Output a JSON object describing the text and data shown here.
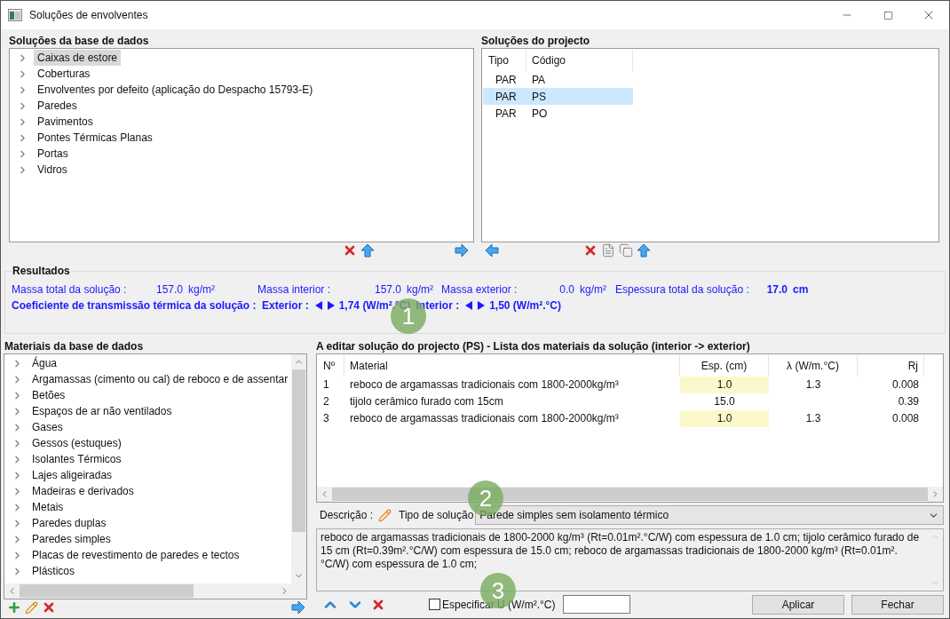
{
  "window": {
    "title": "Soluções de envolventes"
  },
  "database_solutions": {
    "title": "Soluções da base de dados",
    "items": [
      {
        "label": "Caixas de estore",
        "selected": true,
        "expanded": false
      },
      {
        "label": "Coberturas",
        "selected": false,
        "expanded": false
      },
      {
        "label": "Envolventes por defeito (aplicação do Despacho 15793-E)",
        "selected": false,
        "expanded": false
      },
      {
        "label": "Paredes",
        "selected": false,
        "expanded": false
      },
      {
        "label": "Pavimentos",
        "selected": false,
        "expanded": false
      },
      {
        "label": "Pontes Térmicas Planas",
        "selected": false,
        "expanded": false
      },
      {
        "label": "Portas",
        "selected": false,
        "expanded": false
      },
      {
        "label": "Vidros",
        "selected": false,
        "expanded": false
      }
    ]
  },
  "project_solutions": {
    "title": "Soluções do projecto",
    "columns": [
      "Tipo",
      "Código"
    ],
    "rows": [
      {
        "cells": [
          "PAR",
          "PA"
        ],
        "selected": false
      },
      {
        "cells": [
          "PAR",
          "PS"
        ],
        "selected": true
      },
      {
        "cells": [
          "PAR",
          "PO"
        ],
        "selected": false
      }
    ]
  },
  "results": {
    "title": "Resultados",
    "fields": [
      {
        "label": "Massa total da solução :",
        "value": "157.0",
        "unit": "kg/m²",
        "bold": false
      },
      {
        "label": "Massa interior :",
        "value": "157.0",
        "unit": "kg/m²",
        "bold": false
      },
      {
        "label": "Massa exterior :",
        "value": "0.0",
        "unit": "kg/m²",
        "bold": false
      },
      {
        "label": "Espessura total da solução :",
        "value": "17.0",
        "unit": "cm",
        "bold": true
      }
    ],
    "coefficient": {
      "label": "Coeficiente de transmissão térmica da solução :",
      "exterior_label": "Exterior :",
      "exterior_value": "1,74 (W/m².°C)",
      "interior_label": "Interior :",
      "interior_value": "1,50 (W/m².°C)"
    }
  },
  "materials": {
    "title": "Materiais da base de dados",
    "items": [
      {
        "label": "Água",
        "expanded": false
      },
      {
        "label": "Argamassas (cimento ou cal) de reboco e de assentar",
        "expanded": false
      },
      {
        "label": "Betões",
        "expanded": false
      },
      {
        "label": "Espaços de ar não ventilados",
        "expanded": false
      },
      {
        "label": "Gases",
        "expanded": false
      },
      {
        "label": "Gessos (estuques)",
        "expanded": false
      },
      {
        "label": "Isolantes Térmicos",
        "expanded": false
      },
      {
        "label": "Lajes aligeiradas",
        "expanded": false
      },
      {
        "label": "Madeiras e derivados",
        "expanded": false
      },
      {
        "label": "Metais",
        "expanded": false
      },
      {
        "label": "Paredes duplas",
        "expanded": false
      },
      {
        "label": "Paredes simples",
        "expanded": false
      },
      {
        "label": "Placas de revestimento de paredes e tectos",
        "expanded": false
      },
      {
        "label": "Plásticos",
        "expanded": false
      }
    ]
  },
  "editor": {
    "title": "A editar solução do projecto (PS) - Lista dos materiais da solução (interior -> exterior)",
    "columns": [
      "Nº",
      "Material",
      "Esp. (cm)",
      "λ (W/m.°C)",
      "Rj"
    ],
    "rows": [
      {
        "cells": [
          "1",
          "reboco de argamassas tradicionais com 1800-2000kg/m³",
          "1.0",
          "1.3",
          "0.008"
        ],
        "editable": true
      },
      {
        "cells": [
          "2",
          "tijolo cerâmico furado com 15cm",
          "15.0",
          "",
          "0.39"
        ],
        "editable": false
      },
      {
        "cells": [
          "3",
          "reboco de argamassas tradicionais com 1800-2000kg/m³",
          "1.0",
          "1.3",
          "0.008"
        ],
        "editable": true
      }
    ],
    "description_label": "Descrição :",
    "solution_type_label": "Tipo de solução",
    "solution_type": "Parede simples sem isolamento térmico",
    "description": "reboco de argamassas tradicionais de 1800-2000 kg/m³ (Rt=0.01m².°C/W) com espessura de 1.0 cm; tijolo cerâmico furado de 15 cm (Rt=0.39m².°C/W) com espessura de 15.0 cm; reboco de argamassas tradicionais de 1800-2000 kg/m³ (Rt=0.01m².°C/W) com espessura de 1.0 cm;",
    "specify_u": {
      "label": "Especificar U (W/m².°C)",
      "checked": false
    },
    "buttons": [
      "Aplicar",
      "Fechar"
    ]
  },
  "callouts": [
    "1",
    "2",
    "3"
  ]
}
